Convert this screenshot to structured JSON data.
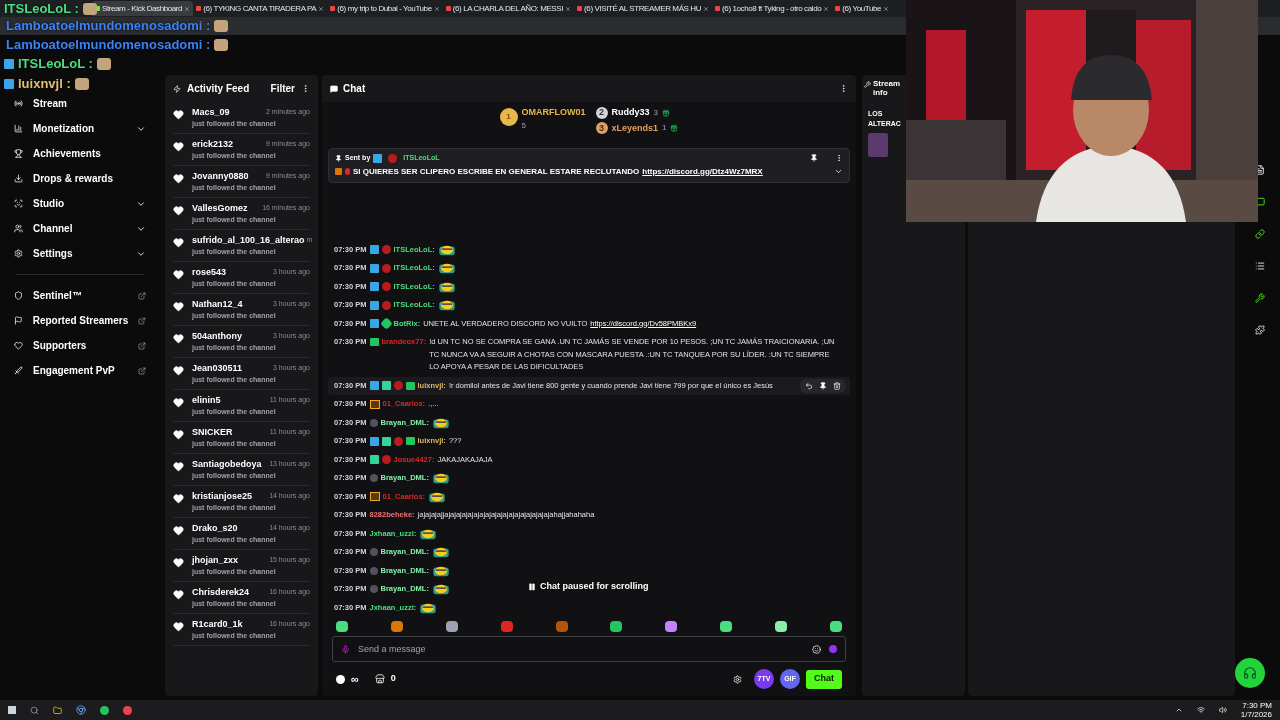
{
  "browser_tabs": [
    {
      "title": "Stream - Kick Dashboard",
      "selected": true
    },
    {
      "title": "(6) TYKING CANTA TIRADERA PA",
      "selected": false
    },
    {
      "title": "(6) my trip to Dubai - YouTube",
      "selected": false
    },
    {
      "title": "(6) LA CHARLA DEL AÑO: MESSI",
      "selected": false
    },
    {
      "title": "(6) VISITÉ AL STREAMER MÁS HU",
      "selected": false
    },
    {
      "title": "(6) 1ocho8 ft Tyking - otro caldo",
      "selected": false
    },
    {
      "title": "(6) YouTube",
      "selected": false
    }
  ],
  "overlay_chat": [
    {
      "user": "ITSLeoLoL :",
      "color": "#4ade80"
    },
    {
      "user": "Lamboatoelmundomenosadomi :",
      "color": "#3b82f6"
    },
    {
      "user": "Lamboatoelmundomenosadomi :",
      "color": "#3b82f6"
    },
    {
      "user": "ITSLeoLoL :",
      "color": "#4ade80"
    },
    {
      "user": "luixnvjl :",
      "color": "#e0c070"
    }
  ],
  "sidebar": {
    "items": [
      {
        "label": "Stream",
        "kind": "stream",
        "chevron": false,
        "external": false
      },
      {
        "label": "Monetization",
        "kind": "chart",
        "chevron": true,
        "external": false
      },
      {
        "label": "Achievements",
        "kind": "trophy",
        "chevron": false,
        "external": false
      },
      {
        "label": "Drops & rewards",
        "kind": "drops",
        "chevron": false,
        "external": false
      },
      {
        "label": "Studio",
        "kind": "studio",
        "chevron": true,
        "external": false
      },
      {
        "label": "Channel",
        "kind": "channel",
        "chevron": true,
        "external": false
      },
      {
        "label": "Settings",
        "kind": "settings",
        "chevron": true,
        "external": false
      }
    ],
    "links": [
      {
        "label": "Sentinel™",
        "kind": "shield",
        "chevron": false,
        "external": true
      },
      {
        "label": "Reported Streamers",
        "kind": "flag",
        "chevron": false,
        "external": true
      },
      {
        "label": "Supporters",
        "kind": "heart",
        "chevron": false,
        "external": true
      },
      {
        "label": "Engagement PvP",
        "kind": "swords",
        "chevron": false,
        "external": true
      }
    ]
  },
  "activity_feed": {
    "title": "Activity Feed",
    "filter": "Filter",
    "events": [
      {
        "name": "Macs_09",
        "time": "2 minutes ago",
        "action": "just followed the channel"
      },
      {
        "name": "erick2132",
        "time": "9 minutes ago",
        "action": "just followed the channel"
      },
      {
        "name": "Jovanny0880",
        "time": "9 minutes ago",
        "action": "just followed the channel"
      },
      {
        "name": "VallesGomez",
        "time": "16 minutes ago",
        "action": "just followed the channel"
      },
      {
        "name": "sufrido_al_100_16_alterao",
        "time": "m",
        "action": "just followed the channel"
      },
      {
        "name": "rose543",
        "time": "3 hours ago",
        "action": "just followed the channel"
      },
      {
        "name": "Nathan12_4",
        "time": "3 hours ago",
        "action": "just followed the channel"
      },
      {
        "name": "504anthony",
        "time": "3 hours ago",
        "action": "just followed the channel"
      },
      {
        "name": "Jean030511",
        "time": "3 hours ago",
        "action": "just followed the channel"
      },
      {
        "name": "elinin5",
        "time": "11 hours ago",
        "action": "just followed the channel"
      },
      {
        "name": "SNICKER",
        "time": "11 hours ago",
        "action": "just followed the channel"
      },
      {
        "name": "Santiagobedoya",
        "time": "13 hours ago",
        "action": "just followed the channel"
      },
      {
        "name": "kristianjose25",
        "time": "14 hours ago",
        "action": "just followed the channel"
      },
      {
        "name": "Drako_s20",
        "time": "14 hours ago",
        "action": "just followed the channel"
      },
      {
        "name": "jhojan_zxx",
        "time": "15 hours ago",
        "action": "just followed the channel"
      },
      {
        "name": "Chrisderek24",
        "time": "16 hours ago",
        "action": "just followed the channel"
      },
      {
        "name": "R1card0_1k",
        "time": "16 hours ago",
        "action": "just followed the channel"
      }
    ]
  },
  "chat": {
    "title": "Chat",
    "leaderboard": [
      {
        "rank": "1",
        "name": "OMARFLOW01",
        "count": "5",
        "color": "#e8b84a"
      },
      {
        "rank": "2",
        "name": "Ruddy33",
        "count": "3",
        "color": "#d1d5db"
      },
      {
        "rank": "3",
        "name": "xLeyends1",
        "count": "1",
        "color": "#e0a060"
      }
    ],
    "pinned": {
      "sent_by": "Sent by",
      "user": "ITSLeoLoL",
      "text": "SI QUIERES SER CLIPERO ESCRIBE EN GENERAL ESTARE RECLUTANDO",
      "link": "https://discord.gg/Dtz4Wz7MRX"
    },
    "messages": [
      {
        "time": "07:30 PM",
        "badges": [
          {
            "kind": "mod"
          },
          {
            "kind": "red"
          }
        ],
        "user": "ITSLeoLoL:",
        "color": "#4ade80",
        "emote": true,
        "hovered": false
      },
      {
        "time": "07:30 PM",
        "badges": [
          {
            "kind": "mod"
          },
          {
            "kind": "red"
          }
        ],
        "user": "ITSLeoLoL:",
        "color": "#4ade80",
        "emote": true,
        "hovered": false
      },
      {
        "time": "07:30 PM",
        "badges": [
          {
            "kind": "mod"
          },
          {
            "kind": "red"
          }
        ],
        "user": "ITSLeoLoL:",
        "color": "#4ade80",
        "emote": true,
        "hovered": false
      },
      {
        "time": "07:30 PM",
        "badges": [
          {
            "kind": "mod"
          },
          {
            "kind": "red"
          }
        ],
        "user": "ITSLeoLoL:",
        "color": "#4ade80",
        "emote": true,
        "hovered": false
      },
      {
        "time": "07:30 PM",
        "badges": [
          {
            "kind": "mod"
          },
          {
            "kind": "verified"
          }
        ],
        "user": "BotRix:",
        "color": "#4ade80",
        "text": "UNETE AL VERDADERO DISCORD NO VUILTO",
        "link": "https://discord.gg/Dv58PMBKx9",
        "hovered": false
      },
      {
        "time": "07:30 PM",
        "badges": [
          {
            "kind": "gift"
          }
        ],
        "user": "brandeox77:",
        "color": "#dc2626",
        "text": "!d UN TC NO SE COMPRA SE GANA .UN TC JAMÁS SE VENDE POR 10 PESOS. ;UN TC JAMÁS TRAICIONARIA. ;UN TC NUNCA VA A SEGUIR A CHOTAS CON MASCARA PUESTA .:UN TC TANQUEA POR SU LÍDER. :UN TC SIEMPRE LO APOYA A PESAR DE LAS DIFICULTADES",
        "hovered": false
      },
      {
        "time": "07:30 PM",
        "badges": [
          {
            "kind": "mod"
          },
          {
            "kind": "sub"
          },
          {
            "kind": "red"
          },
          {
            "kind": "gift"
          }
        ],
        "user": "luixnvjl:",
        "color": "#e0b860",
        "text": "!r domilol antes de Javi tiene 800 gente y cuando prende Javi tiene 799 por que el único es Jesús",
        "hovered": true
      },
      {
        "time": "07:30 PM",
        "badges": [
          {
            "kind": "crown"
          }
        ],
        "user": "01_Caarlos:",
        "color": "#dc2626",
        "text": ".,...",
        "hovered": false
      },
      {
        "time": "07:30 PM",
        "badges": [
          {
            "kind": "dot"
          }
        ],
        "user": "Brayan_DML:",
        "color": "#86efac",
        "emote": true,
        "hovered": false
      },
      {
        "time": "07:30 PM",
        "badges": [
          {
            "kind": "mod"
          },
          {
            "kind": "sub"
          },
          {
            "kind": "red"
          },
          {
            "kind": "gift"
          }
        ],
        "user": "luixnvjl:",
        "color": "#e0b860",
        "text": "???",
        "hovered": false
      },
      {
        "time": "07:30 PM",
        "badges": [
          {
            "kind": "sub"
          },
          {
            "kind": "red"
          }
        ],
        "user": "Josue4427:",
        "color": "#dc2626",
        "text": "JAKAJAKAJAJA",
        "hovered": false
      },
      {
        "time": "07:30 PM",
        "badges": [
          {
            "kind": "dot"
          }
        ],
        "user": "Brayan_DML:",
        "color": "#86efac",
        "emote": true,
        "hovered": false
      },
      {
        "time": "07:30 PM",
        "badges": [
          {
            "kind": "crown"
          }
        ],
        "user": "01_Caarlos:",
        "color": "#dc2626",
        "emote": true,
        "hovered": false
      },
      {
        "time": "07:30 PM",
        "user": "8282beheke:",
        "color": "#f87171",
        "text": "jajajajajjajajajajajajajajajajajajajajajajajajahajjahahaha",
        "hovered": false
      },
      {
        "time": "07:30 PM",
        "user": "Jxhaan_uzzi:",
        "color": "#4ade80",
        "emote": true,
        "hovered": false
      },
      {
        "time": "07:30 PM",
        "badges": [
          {
            "kind": "dot"
          }
        ],
        "user": "Brayan_DML:",
        "color": "#86efac",
        "emote": true,
        "hovered": false
      },
      {
        "time": "07:30 PM",
        "badges": [
          {
            "kind": "dot"
          }
        ],
        "user": "Brayan_DML:",
        "color": "#86efac",
        "emote": true,
        "hovered": false
      },
      {
        "time": "07:30 PM",
        "badges": [
          {
            "kind": "dot"
          }
        ],
        "user": "Brayan_DML:",
        "color": "#86efac",
        "emote": true,
        "hovered": false
      },
      {
        "time": "07:30 PM",
        "user": "Jxhaan_uzzi:",
        "color": "#4ade80",
        "emote": true,
        "hovered": false
      }
    ],
    "paused_notice": "Chat paused for scrolling",
    "emote_bar": [
      {
        "color": "#4ade80"
      },
      {
        "color": "#d97706"
      },
      {
        "color": "#9ca3af"
      },
      {
        "color": "#dc2626"
      },
      {
        "color": "#b45309"
      },
      {
        "color": "#22c55e"
      },
      {
        "color": "#c084fc"
      },
      {
        "color": "#4ade80"
      },
      {
        "color": "#86efac"
      },
      {
        "color": "#4ade80"
      }
    ],
    "input": {
      "placeholder": "Send a message"
    },
    "points": "∞",
    "store_count": "0",
    "seventv": "7TV",
    "gif": "GIF",
    "send": "Chat"
  },
  "stream_info": {
    "title": "Stream info",
    "stream_title": "LOS ALTERAC"
  },
  "right_rail": [
    {
      "kind": "doc",
      "highlighted": false
    },
    {
      "kind": "chat",
      "highlighted": true
    },
    {
      "kind": "link",
      "highlighted": true
    },
    {
      "kind": "list",
      "highlighted": false
    },
    {
      "kind": "wrench",
      "highlighted": true
    },
    {
      "kind": "puzzle",
      "highlighted": false
    }
  ],
  "taskbar": {
    "time": "7:30 PM",
    "date": "1/7/2026"
  }
}
